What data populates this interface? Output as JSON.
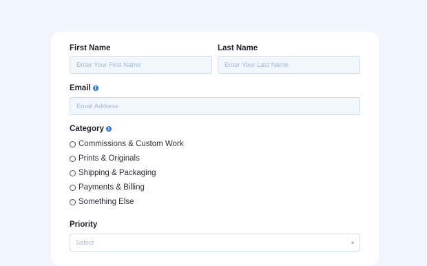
{
  "form": {
    "first_name": {
      "label": "First Name",
      "placeholder": "Enter Your First Name"
    },
    "last_name": {
      "label": "Last Name",
      "placeholder": "Enter Your Last Name"
    },
    "email": {
      "label": "Email",
      "placeholder": "Email Address"
    },
    "category": {
      "label": "Category",
      "options": [
        "Commissions & Custom Work",
        "Prints & Originals",
        "Shipping & Packaging",
        "Payments & Billing",
        "Something Else"
      ]
    },
    "priority": {
      "label": "Priority",
      "placeholder": "Select"
    }
  },
  "icons": {
    "info": "info-icon",
    "chevron": "chevron-down-icon"
  },
  "colors": {
    "background": "#f1f5fd",
    "card": "#ffffff",
    "input_fill": "#f2f7fe",
    "info_icon": "#2f7de1"
  }
}
